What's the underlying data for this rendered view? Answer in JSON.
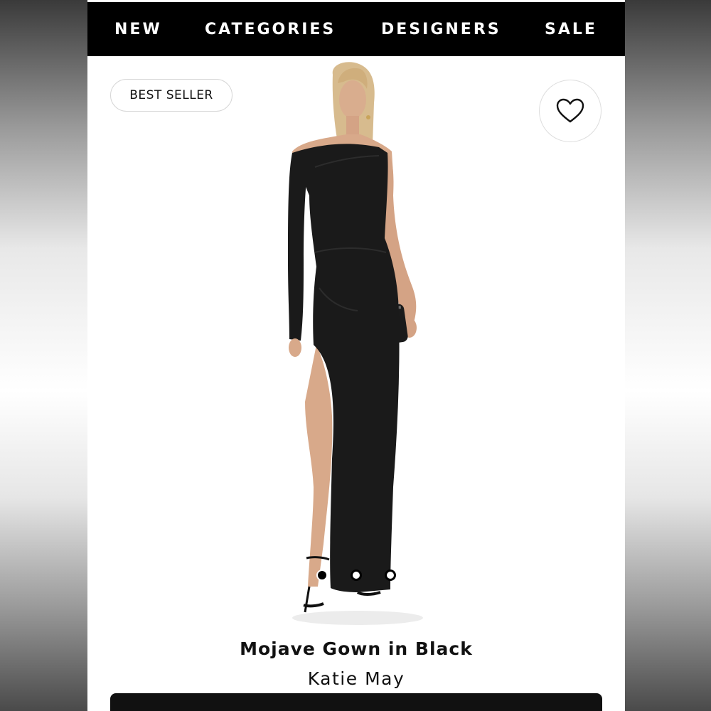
{
  "nav": {
    "items": [
      {
        "label": "NEW"
      },
      {
        "label": "CATEGORIES"
      },
      {
        "label": "DESIGNERS"
      },
      {
        "label": "SALE"
      }
    ]
  },
  "badge": {
    "label": "BEST SELLER"
  },
  "favorite": {
    "icon": "heart-outline-icon"
  },
  "image_carousel": {
    "count": 3,
    "active_index": 0
  },
  "product": {
    "name": "Mojave Gown in Black",
    "designer": "Katie May"
  },
  "colors": {
    "nav_bg": "#000000",
    "nav_text": "#ffffff",
    "text": "#111111",
    "dress": "#1a1a1a",
    "skin": "#d8a98a",
    "hair": "#d7bb8e",
    "cta_bg": "#111111"
  }
}
